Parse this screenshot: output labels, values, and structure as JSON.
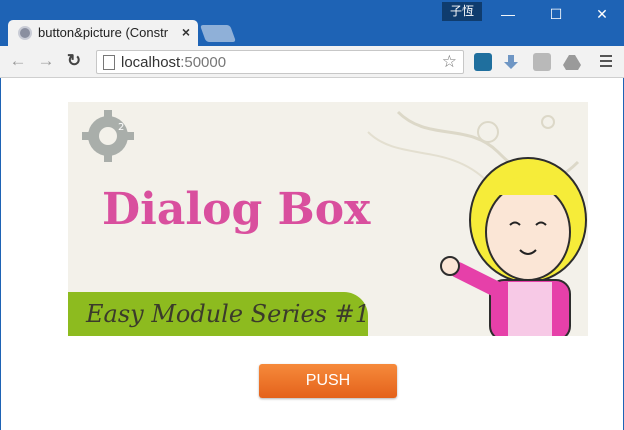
{
  "window": {
    "user_badge": "子恆",
    "controls": {
      "minimize": "—",
      "maximize": "☐",
      "close": "✕"
    }
  },
  "tab": {
    "title": "button&picture (Constr",
    "close": "×"
  },
  "toolbar": {
    "url_host": "localhost",
    "url_port": ":50000",
    "back": "←",
    "forward": "→",
    "reload": "↻",
    "star": "☆"
  },
  "banner": {
    "title": "Dialog Box",
    "subtitle": "Easy Module Series #1",
    "gear_number": "2"
  },
  "button": {
    "label": "PUSH"
  },
  "colors": {
    "titlebar": "#1e63b5",
    "banner_title": "#d94f9e",
    "series_band": "#8dbb1f",
    "push_button": "#ef7428"
  },
  "icons": [
    "back-icon",
    "forward-icon",
    "reload-icon",
    "page-icon",
    "star-icon",
    "extension-icons",
    "menu-icon"
  ]
}
